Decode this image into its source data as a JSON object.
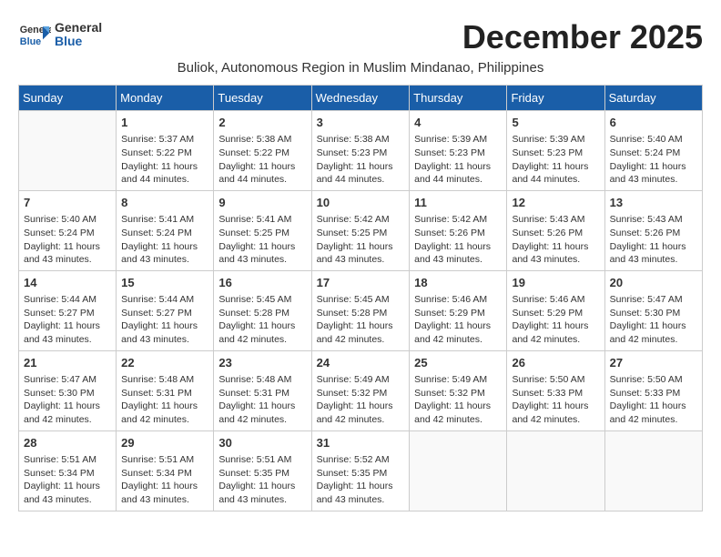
{
  "logo": {
    "general": "General",
    "blue": "Blue"
  },
  "title": "December 2025",
  "subtitle": "Buliok, Autonomous Region in Muslim Mindanao, Philippines",
  "weekdays": [
    "Sunday",
    "Monday",
    "Tuesday",
    "Wednesday",
    "Thursday",
    "Friday",
    "Saturday"
  ],
  "weeks": [
    [
      {
        "day": "",
        "info": ""
      },
      {
        "day": "1",
        "info": "Sunrise: 5:37 AM\nSunset: 5:22 PM\nDaylight: 11 hours\nand 44 minutes."
      },
      {
        "day": "2",
        "info": "Sunrise: 5:38 AM\nSunset: 5:22 PM\nDaylight: 11 hours\nand 44 minutes."
      },
      {
        "day": "3",
        "info": "Sunrise: 5:38 AM\nSunset: 5:23 PM\nDaylight: 11 hours\nand 44 minutes."
      },
      {
        "day": "4",
        "info": "Sunrise: 5:39 AM\nSunset: 5:23 PM\nDaylight: 11 hours\nand 44 minutes."
      },
      {
        "day": "5",
        "info": "Sunrise: 5:39 AM\nSunset: 5:23 PM\nDaylight: 11 hours\nand 44 minutes."
      },
      {
        "day": "6",
        "info": "Sunrise: 5:40 AM\nSunset: 5:24 PM\nDaylight: 11 hours\nand 43 minutes."
      }
    ],
    [
      {
        "day": "7",
        "info": "Sunrise: 5:40 AM\nSunset: 5:24 PM\nDaylight: 11 hours\nand 43 minutes."
      },
      {
        "day": "8",
        "info": "Sunrise: 5:41 AM\nSunset: 5:24 PM\nDaylight: 11 hours\nand 43 minutes."
      },
      {
        "day": "9",
        "info": "Sunrise: 5:41 AM\nSunset: 5:25 PM\nDaylight: 11 hours\nand 43 minutes."
      },
      {
        "day": "10",
        "info": "Sunrise: 5:42 AM\nSunset: 5:25 PM\nDaylight: 11 hours\nand 43 minutes."
      },
      {
        "day": "11",
        "info": "Sunrise: 5:42 AM\nSunset: 5:26 PM\nDaylight: 11 hours\nand 43 minutes."
      },
      {
        "day": "12",
        "info": "Sunrise: 5:43 AM\nSunset: 5:26 PM\nDaylight: 11 hours\nand 43 minutes."
      },
      {
        "day": "13",
        "info": "Sunrise: 5:43 AM\nSunset: 5:26 PM\nDaylight: 11 hours\nand 43 minutes."
      }
    ],
    [
      {
        "day": "14",
        "info": "Sunrise: 5:44 AM\nSunset: 5:27 PM\nDaylight: 11 hours\nand 43 minutes."
      },
      {
        "day": "15",
        "info": "Sunrise: 5:44 AM\nSunset: 5:27 PM\nDaylight: 11 hours\nand 43 minutes."
      },
      {
        "day": "16",
        "info": "Sunrise: 5:45 AM\nSunset: 5:28 PM\nDaylight: 11 hours\nand 42 minutes."
      },
      {
        "day": "17",
        "info": "Sunrise: 5:45 AM\nSunset: 5:28 PM\nDaylight: 11 hours\nand 42 minutes."
      },
      {
        "day": "18",
        "info": "Sunrise: 5:46 AM\nSunset: 5:29 PM\nDaylight: 11 hours\nand 42 minutes."
      },
      {
        "day": "19",
        "info": "Sunrise: 5:46 AM\nSunset: 5:29 PM\nDaylight: 11 hours\nand 42 minutes."
      },
      {
        "day": "20",
        "info": "Sunrise: 5:47 AM\nSunset: 5:30 PM\nDaylight: 11 hours\nand 42 minutes."
      }
    ],
    [
      {
        "day": "21",
        "info": "Sunrise: 5:47 AM\nSunset: 5:30 PM\nDaylight: 11 hours\nand 42 minutes."
      },
      {
        "day": "22",
        "info": "Sunrise: 5:48 AM\nSunset: 5:31 PM\nDaylight: 11 hours\nand 42 minutes."
      },
      {
        "day": "23",
        "info": "Sunrise: 5:48 AM\nSunset: 5:31 PM\nDaylight: 11 hours\nand 42 minutes."
      },
      {
        "day": "24",
        "info": "Sunrise: 5:49 AM\nSunset: 5:32 PM\nDaylight: 11 hours\nand 42 minutes."
      },
      {
        "day": "25",
        "info": "Sunrise: 5:49 AM\nSunset: 5:32 PM\nDaylight: 11 hours\nand 42 minutes."
      },
      {
        "day": "26",
        "info": "Sunrise: 5:50 AM\nSunset: 5:33 PM\nDaylight: 11 hours\nand 42 minutes."
      },
      {
        "day": "27",
        "info": "Sunrise: 5:50 AM\nSunset: 5:33 PM\nDaylight: 11 hours\nand 42 minutes."
      }
    ],
    [
      {
        "day": "28",
        "info": "Sunrise: 5:51 AM\nSunset: 5:34 PM\nDaylight: 11 hours\nand 43 minutes."
      },
      {
        "day": "29",
        "info": "Sunrise: 5:51 AM\nSunset: 5:34 PM\nDaylight: 11 hours\nand 43 minutes."
      },
      {
        "day": "30",
        "info": "Sunrise: 5:51 AM\nSunset: 5:35 PM\nDaylight: 11 hours\nand 43 minutes."
      },
      {
        "day": "31",
        "info": "Sunrise: 5:52 AM\nSunset: 5:35 PM\nDaylight: 11 hours\nand 43 minutes."
      },
      {
        "day": "",
        "info": ""
      },
      {
        "day": "",
        "info": ""
      },
      {
        "day": "",
        "info": ""
      }
    ]
  ]
}
